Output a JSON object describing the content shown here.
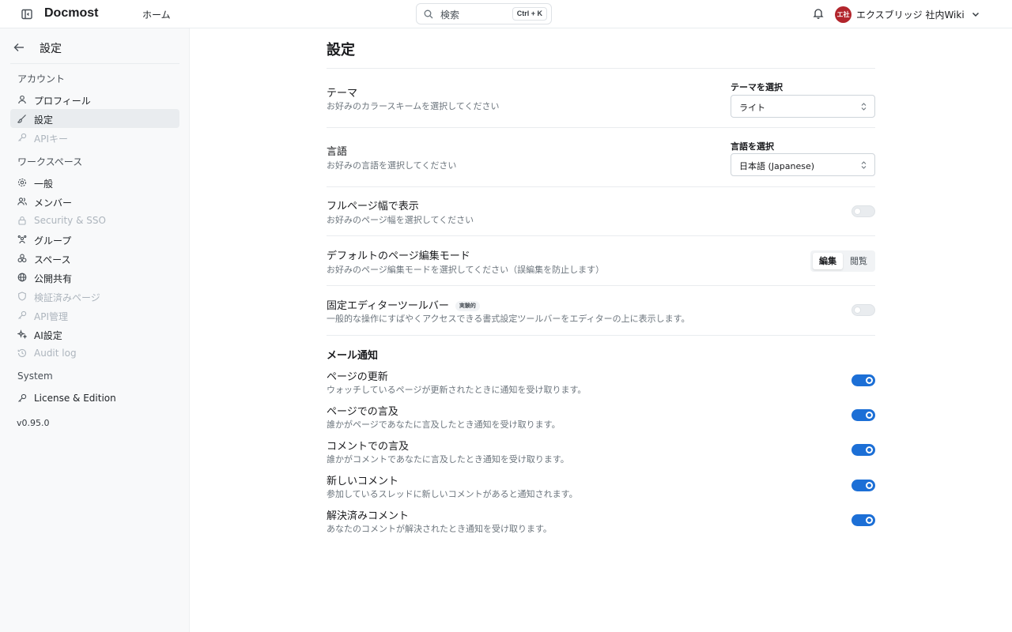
{
  "header": {
    "brand": "Docmost",
    "home_label": "ホーム",
    "search_placeholder": "検索",
    "search_shortcut": "Ctrl + K",
    "workspace_initials": "エ社",
    "workspace_name": "エクスブリッジ 社内Wiki"
  },
  "sidebar": {
    "title": "設定",
    "sections": {
      "account": "アカウント",
      "workspace": "ワークスペース",
      "system": "System"
    },
    "account_items": [
      {
        "label": "プロフィール",
        "icon": "user-icon",
        "state": "normal"
      },
      {
        "label": "設定",
        "icon": "brush-icon",
        "state": "active"
      },
      {
        "label": "APIキー",
        "icon": "key-icon",
        "state": "disabled"
      }
    ],
    "workspace_items": [
      {
        "label": "一般",
        "icon": "gear-icon",
        "state": "normal"
      },
      {
        "label": "メンバー",
        "icon": "users-icon",
        "state": "normal"
      },
      {
        "label": "Security & SSO",
        "icon": "lock-icon",
        "state": "disabled"
      },
      {
        "label": "グループ",
        "icon": "group-icon",
        "state": "normal"
      },
      {
        "label": "スペース",
        "icon": "spaces-icon",
        "state": "normal"
      },
      {
        "label": "公開共有",
        "icon": "globe-icon",
        "state": "normal"
      },
      {
        "label": "検証済みページ",
        "icon": "shield-icon",
        "state": "disabled"
      },
      {
        "label": "API管理",
        "icon": "key-icon",
        "state": "disabled"
      },
      {
        "label": "AI設定",
        "icon": "sparkles-icon",
        "state": "normal"
      },
      {
        "label": "Audit log",
        "icon": "history-icon",
        "state": "disabled"
      }
    ],
    "system_items": [
      {
        "label": "License & Edition",
        "icon": "key-icon",
        "state": "normal"
      }
    ],
    "version": "v0.95.0"
  },
  "main": {
    "title": "設定",
    "theme": {
      "title": "テーマ",
      "desc": "お好みのカラースキームを選択してください",
      "select_label": "テーマを選択",
      "value": "ライト"
    },
    "language": {
      "title": "言語",
      "desc": "お好みの言語を選択してください",
      "select_label": "言語を選択",
      "value": "日本語 (Japanese)"
    },
    "full_width": {
      "title": "フルページ幅で表示",
      "desc": "お好みのページ幅を選択してください",
      "enabled": false
    },
    "edit_mode": {
      "title": "デフォルトのページ編集モード",
      "desc": "お好みのページ編集モードを選択してください（誤編集を防止します）",
      "options": [
        "編集",
        "閲覧"
      ],
      "selected": "編集"
    },
    "toolbar": {
      "title": "固定エディターツールバー",
      "badge": "実験的",
      "desc": "一般的な操作にすばやくアクセスできる書式設定ツールバーをエディターの上に表示します。",
      "enabled": false
    },
    "email": {
      "heading": "メール通知",
      "items": [
        {
          "title": "ページの更新",
          "desc": "ウォッチしているページが更新されたときに通知を受け取ります。",
          "enabled": true
        },
        {
          "title": "ページでの言及",
          "desc": "誰かがページであなたに言及したとき通知を受け取ります。",
          "enabled": true
        },
        {
          "title": "コメントでの言及",
          "desc": "誰かがコメントであなたに言及したとき通知を受け取ります。",
          "enabled": true
        },
        {
          "title": "新しいコメント",
          "desc": "参加しているスレッドに新しいコメントがあると通知されます。",
          "enabled": true
        },
        {
          "title": "解決済みコメント",
          "desc": "あなたのコメントが解決されたとき通知を受け取ります。",
          "enabled": true
        }
      ]
    }
  },
  "colors": {
    "accent": "#1c6fd6",
    "avatar": "#b2252c",
    "sidebar_bg": "#f8f9fa"
  }
}
